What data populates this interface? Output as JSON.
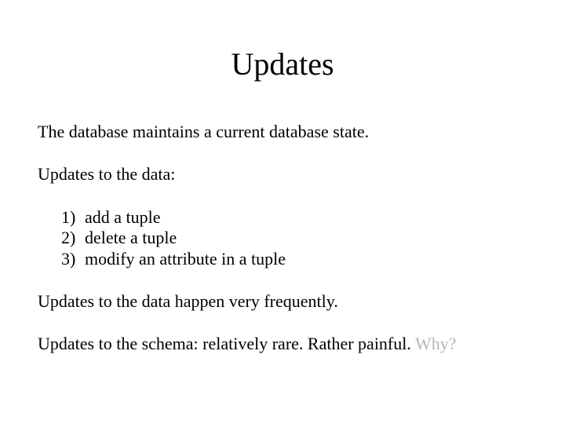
{
  "title": "Updates",
  "line1": "The database maintains a current database state.",
  "line2": "Updates to the data:",
  "list": {
    "n1": "1)",
    "t1": "add a tuple",
    "n2": "2)",
    "t2": "delete a tuple",
    "n3": "3)",
    "t3": "modify an attribute in a tuple"
  },
  "line3": "Updates to the data happen very frequently.",
  "line4a": "Updates to the schema: relatively rare. Rather painful. ",
  "line4b": "Why?"
}
